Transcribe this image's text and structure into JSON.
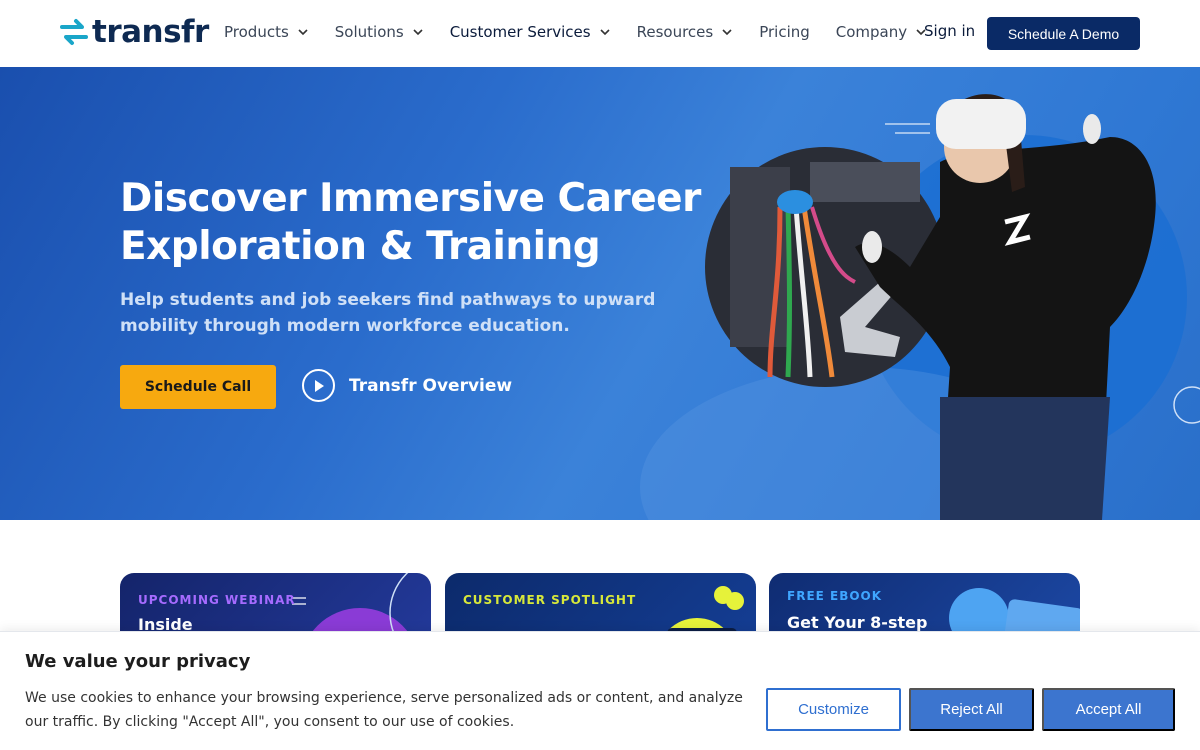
{
  "header": {
    "logo_text": "transfr",
    "nav": [
      {
        "label": "Products",
        "has_dropdown": true
      },
      {
        "label": "Solutions",
        "has_dropdown": true
      },
      {
        "label": "Customer Services",
        "has_dropdown": true
      },
      {
        "label": "Resources",
        "has_dropdown": true
      },
      {
        "label": "Pricing",
        "has_dropdown": false
      },
      {
        "label": "Company",
        "has_dropdown": true
      }
    ],
    "signin_label": "Sign in",
    "demo_label": "Schedule A Demo"
  },
  "hero": {
    "title": "Discover Immersive Career Exploration & Training",
    "subtitle": "Help students and job seekers find pathways to upward mobility through modern workforce education.",
    "cta_label": "Schedule Call",
    "video_label": "Transfr Overview"
  },
  "cards": [
    {
      "tag": "UPCOMING WEBINAR",
      "title": "Inside",
      "tag_color": "#a66bff"
    },
    {
      "tag": "CUSTOMER SPOTLIGHT",
      "title": "",
      "tag_color": "#d7e83a"
    },
    {
      "tag": "FREE EBOOK",
      "title": "Get Your 8-step",
      "tag_color": "#3fa6ff"
    }
  ],
  "cookie": {
    "title": "We value your privacy",
    "text": "We use cookies to enhance your browsing experience, serve personalized ads or content, and analyze our traffic. By clicking \"Accept All\", you consent to our use of cookies.",
    "customize_label": "Customize",
    "reject_label": "Reject All",
    "accept_label": "Accept All"
  },
  "colors": {
    "brand_navy": "#0a2a66",
    "cta_yellow": "#f7a90f",
    "hero_blue": "#2a6ccc",
    "cookie_blue": "#3c75cf",
    "logo_teal": "#1aa6c9"
  }
}
